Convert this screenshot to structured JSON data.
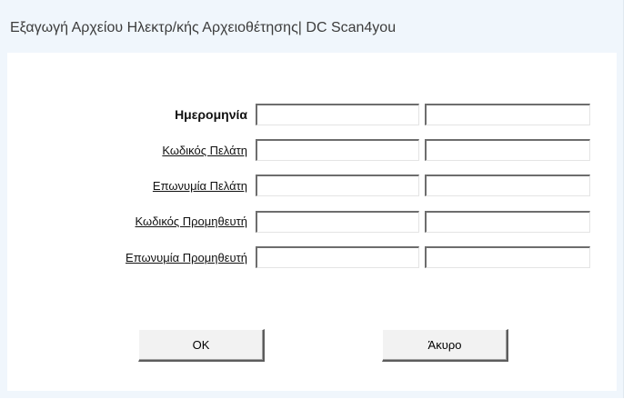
{
  "window": {
    "title": "Εξαγωγή Αρχείου Ηλεκτρ/κής Αρχειοθέτησης| DC Scan4you"
  },
  "form": {
    "rows": [
      {
        "label": "Ημερομηνία",
        "from_value": "",
        "to_value": ""
      },
      {
        "label": "Κωδικός Πελάτη",
        "from_value": "",
        "to_value": ""
      },
      {
        "label": "Επωνυμία Πελάτη",
        "from_value": "",
        "to_value": ""
      },
      {
        "label": "Κωδικός Προμηθευτή",
        "from_value": "",
        "to_value": ""
      },
      {
        "label": "Επωνυμία Προμηθευτή",
        "from_value": "",
        "to_value": ""
      }
    ]
  },
  "buttons": {
    "ok_label": "OK",
    "cancel_label": "Άκυρο"
  },
  "colors": {
    "frame": "#f0f6fc",
    "client": "#ffffff",
    "title_text": "#3c3c3c"
  }
}
